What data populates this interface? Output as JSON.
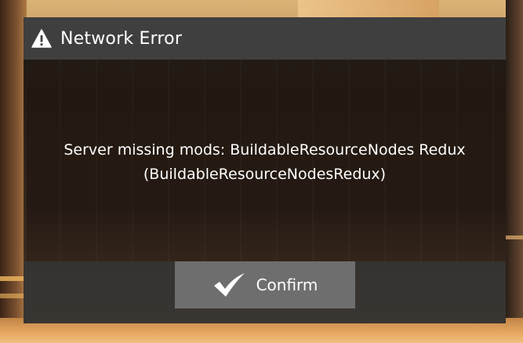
{
  "dialog": {
    "title": "Network Error",
    "title_icon": "warning-icon",
    "message_line1": "Server missing mods: BuildableResourceNodes Redux",
    "message_line2": "(BuildableResourceNodesRedux)",
    "confirm_label": "Confirm",
    "confirm_icon": "checkmark-icon"
  },
  "colors": {
    "titlebar": "#3f3f3f",
    "button": "#6e6e6e",
    "text": "#ffffff"
  }
}
